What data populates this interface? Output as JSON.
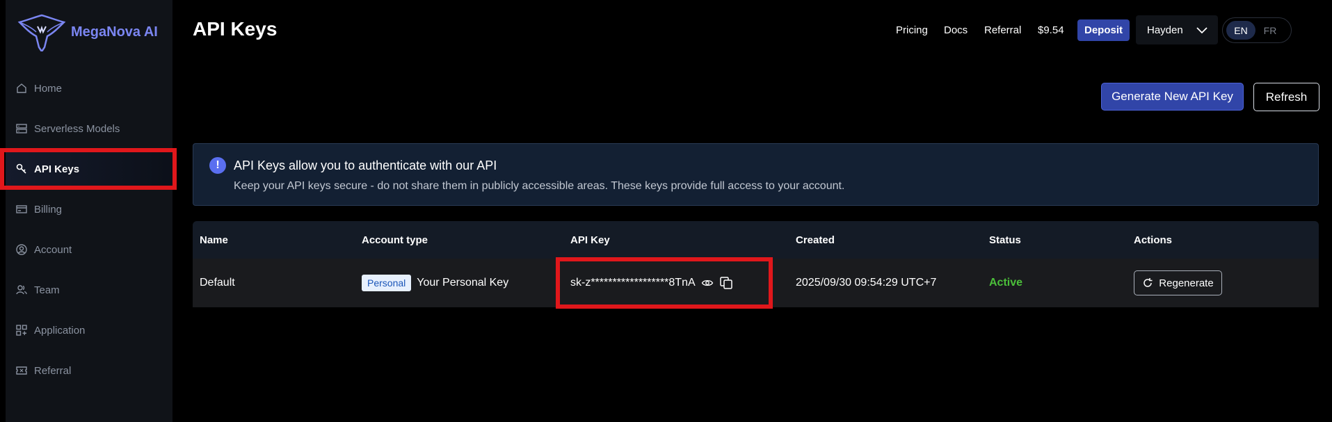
{
  "brand": {
    "name": "MegaNova AI"
  },
  "sidebar": {
    "items": [
      {
        "label": "Home",
        "icon": "home-icon"
      },
      {
        "label": "Serverless Models",
        "icon": "server-icon"
      },
      {
        "label": "API Keys",
        "icon": "key-icon",
        "active": true
      },
      {
        "label": "Billing",
        "icon": "credit-card-icon"
      },
      {
        "label": "Account",
        "icon": "user-circle-icon"
      },
      {
        "label": "Team",
        "icon": "users-icon"
      },
      {
        "label": "Application",
        "icon": "apps-icon"
      },
      {
        "label": "Referral",
        "icon": "ticket-icon"
      }
    ]
  },
  "header": {
    "title": "API Keys",
    "nav": {
      "pricing": "Pricing",
      "docs": "Docs",
      "referral": "Referral",
      "balance": "$9.54"
    },
    "deposit_label": "Deposit",
    "user_name": "Hayden",
    "languages": {
      "active": "EN",
      "other": "FR"
    }
  },
  "actions": {
    "generate_label": "Generate New API Key",
    "refresh_label": "Refresh"
  },
  "alert": {
    "title": "API Keys allow you to authenticate with our API",
    "body": "Keep your API keys secure - do not share them in publicly accessible areas. These keys provide full access to your account."
  },
  "table": {
    "headers": {
      "name": "Name",
      "account_type": "Account type",
      "api_key": "API Key",
      "created": "Created",
      "status": "Status",
      "actions": "Actions"
    },
    "rows": [
      {
        "name": "Default",
        "account_badge": "Personal",
        "account_desc": "Your Personal Key",
        "api_key": "sk-z******************8TnA",
        "created": "2025/09/30 09:54:29 UTC+7",
        "status": "Active",
        "action_label": "Regenerate"
      }
    ]
  },
  "colors": {
    "accent": "#3145a8",
    "highlight": "#e0171b",
    "status_active": "#4bbf3a",
    "brand_text": "#7b86f2"
  }
}
